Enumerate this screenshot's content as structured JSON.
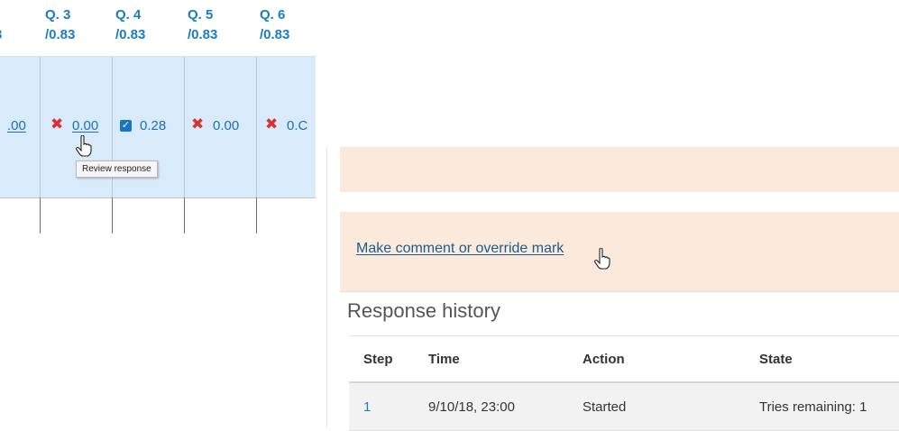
{
  "grades_table": {
    "questions": [
      {
        "title": "3",
        "max": ""
      },
      {
        "title": "Q. 3",
        "max": "/0.83"
      },
      {
        "title": "Q. 4",
        "max": "/0.83"
      },
      {
        "title": "Q. 5",
        "max": "/0.83"
      },
      {
        "title": "Q. 6",
        "max": "/0.83"
      }
    ],
    "cells": [
      {
        "mark": "none",
        "value": ".00"
      },
      {
        "mark": "incorrect-icon",
        "value": "0.00"
      },
      {
        "mark": "partially-correct-icon",
        "value": "0.28"
      },
      {
        "mark": "incorrect-icon",
        "value": "0.00"
      },
      {
        "mark": "incorrect-icon",
        "value": "0.C"
      }
    ],
    "tooltip": "Review response",
    "colors": {
      "header": "#1a7dc4",
      "row_bg": "#d9eafb",
      "incorrect": "#d9322e",
      "check": "#1b74c2"
    }
  },
  "review": {
    "comment_link": "Make comment or override mark",
    "history_title": "Response history",
    "columns": [
      "Step",
      "Time",
      "Action",
      "State"
    ],
    "rows": [
      [
        "1",
        "9/10/18, 23:00",
        "Started",
        "Tries remaining: 1"
      ]
    ],
    "colors": {
      "peach": "#fbeadc",
      "link": "#1a5c8f"
    }
  }
}
